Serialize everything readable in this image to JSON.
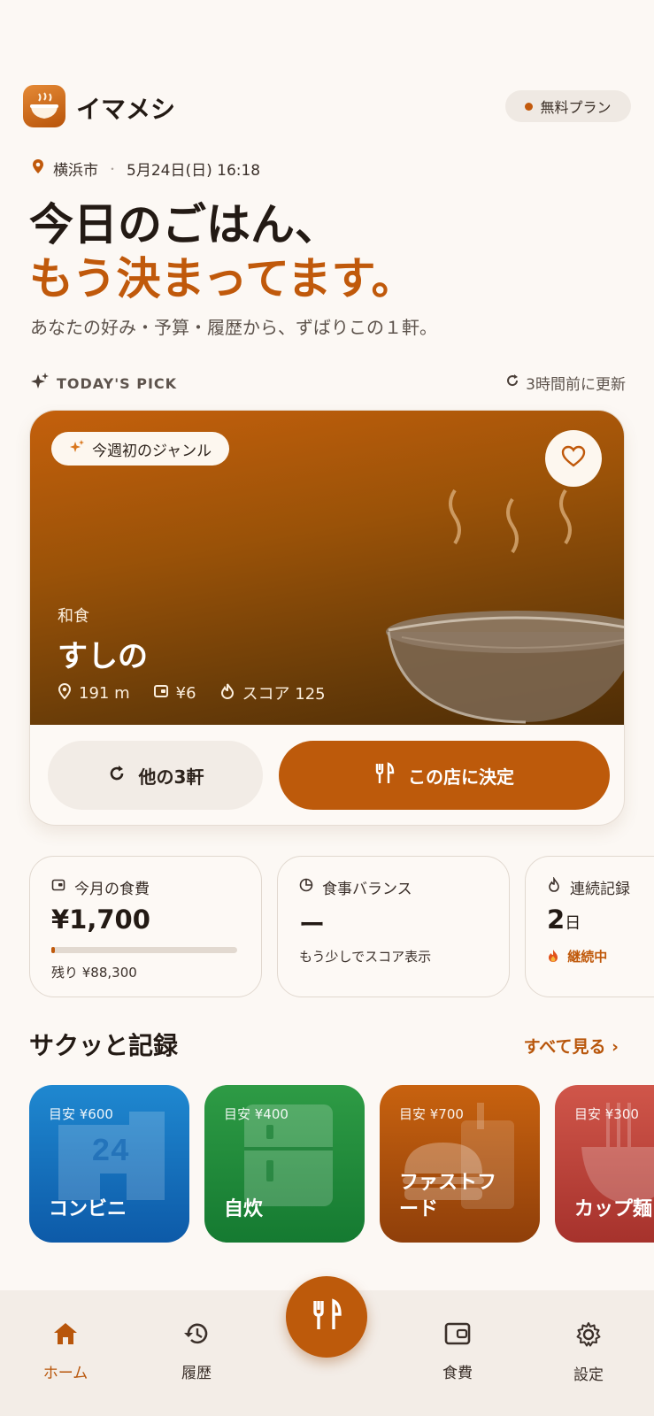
{
  "app": {
    "name": "イマメシ",
    "plan_badge": "無料プラン"
  },
  "location": {
    "city": "横浜市",
    "datetime": "5月24日(日) 16:18"
  },
  "hero": {
    "headline_line1": "今日のごはん、",
    "headline_line2": "もう決まってます。",
    "subline": "あなたの好み・予算・履歴から、ずばりこの１軒。"
  },
  "pick": {
    "section_label": "TODAY'S PICK",
    "refresh_label": "3時間前に更新",
    "genre_chip": "今週初のジャンル",
    "cuisine": "和食",
    "shop_name": "すしの",
    "distance": "191 m",
    "price": "¥6",
    "score": "スコア 125",
    "others_button": "他の3軒",
    "decide_button": "この店に決定"
  },
  "stats": [
    {
      "title": "今月の食費",
      "value": "¥1,700",
      "sub": "残り ¥88,300",
      "progress_fraction": 0.019
    },
    {
      "title": "食事バランス",
      "value": "ー",
      "sub": "もう少しでスコア表示"
    },
    {
      "title": "連続記録",
      "value": "2",
      "unit": "日",
      "sub": "継続中"
    }
  ],
  "quick": {
    "title": "サクッと記録",
    "see_all": "すべて見る ›",
    "cards": [
      {
        "budget": "目安 ¥600",
        "name": "コンビニ",
        "icon": "convenience-store-icon"
      },
      {
        "budget": "目安 ¥400",
        "name": "自炊",
        "icon": "fridge-icon"
      },
      {
        "budget": "目安 ¥700",
        "name": "ファストフード",
        "name_line1": "ファストフ",
        "name_line2": "ード",
        "icon": "burger-icon"
      },
      {
        "budget": "目安 ¥300",
        "name": "カップ麺",
        "icon": "noodle-bowl-icon"
      }
    ]
  },
  "nav": {
    "home": "ホーム",
    "history": "履歴",
    "expense": "食費",
    "settings": "設定"
  },
  "colors": {
    "accent": "#bd5a0b",
    "background": "#fcf8f4",
    "convenience": "#1a73c0",
    "cooking": "#23913f",
    "fastfood": "#b5520e",
    "cupnoodle": "#c9403a"
  }
}
